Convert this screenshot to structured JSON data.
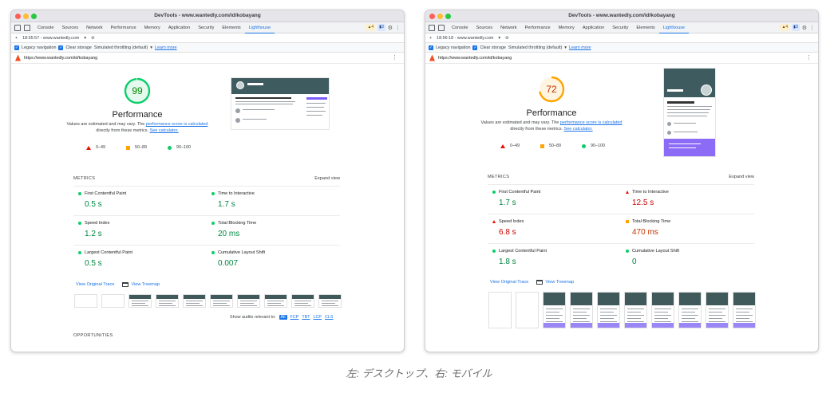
{
  "caption": "左: デスクトップ、右: モバイル",
  "colors": {
    "pass": "#0cce6b",
    "average": "#ffa400",
    "fail": "#eb0f00",
    "link": "#1a73e8"
  },
  "windows": {
    "left": {
      "title": "DevTools - www.wantedly.com/id/kobayang",
      "tabs": [
        "Console",
        "Sources",
        "Network",
        "Performance",
        "Memory",
        "Application",
        "Security",
        "Elements",
        "Lighthouse"
      ],
      "active_tab": "Lighthouse",
      "badges": {
        "warnings": "4",
        "messages": "3"
      },
      "session": "18:55:57 - www.wantedly.com",
      "options": {
        "legacy": "Legacy navigation",
        "clear": "Clear storage",
        "throttle": "Simulated throttling (default)",
        "learn": "Learn more"
      },
      "url": "https://www.wantedly.com/id/kobayang",
      "score": 99,
      "score_color": "#0cce6b",
      "score_text_color": "#008800",
      "score_bg": "#e6f9ee",
      "category": "Performance",
      "desc_1": "Values are estimated and may vary. The ",
      "desc_link": "performance score is calculated",
      "desc_2": " directly from these metrics. ",
      "desc_calc": "See calculator.",
      "legend": {
        "fail": "0–49",
        "average": "50–89",
        "pass": "90–100"
      },
      "metrics_label": "METRICS",
      "expand": "Expand view",
      "metrics": [
        {
          "name": "First Contentful Paint",
          "value": "0.5 s",
          "rating": "pass"
        },
        {
          "name": "Time to Interactive",
          "value": "1.7 s",
          "rating": "pass"
        },
        {
          "name": "Speed Index",
          "value": "1.2 s",
          "rating": "pass"
        },
        {
          "name": "Total Blocking Time",
          "value": "20 ms",
          "rating": "pass"
        },
        {
          "name": "Largest Contentful Paint",
          "value": "0.5 s",
          "rating": "pass"
        },
        {
          "name": "Cumulative Layout Shift",
          "value": "0.007",
          "rating": "pass"
        }
      ],
      "view_trace": "View Original Trace",
      "view_treemap": "View Treemap",
      "show_audits": "Show audits relevant to:",
      "audit_chips": [
        "All",
        "FCP",
        "TBT",
        "LCP",
        "CLS"
      ],
      "opportunities": "OPPORTUNITIES"
    },
    "right": {
      "title": "DevTools - www.wantedly.com/id/kobayang",
      "tabs": [
        "Console",
        "Sources",
        "Network",
        "Performance",
        "Memory",
        "Application",
        "Security",
        "Elements",
        "Lighthouse"
      ],
      "active_tab": "Lighthouse",
      "badges": {
        "warnings": "4",
        "messages": "3"
      },
      "session": "18:56:18 - www.wantedly.com",
      "options": {
        "legacy": "Legacy navigation",
        "clear": "Clear storage",
        "throttle": "Simulated throttling (default)",
        "learn": "Learn more"
      },
      "url": "https://www.wantedly.com/id/kobayang",
      "score": 72,
      "score_color": "#ffa400",
      "score_text_color": "#c33300",
      "score_bg": "#fff4e0",
      "category": "Performance",
      "desc_1": "Values are estimated and may vary. The ",
      "desc_link": "performance score is calculated",
      "desc_2": " directly from these metrics. ",
      "desc_calc": "See calculator.",
      "legend": {
        "fail": "0–49",
        "average": "50–89",
        "pass": "90–100"
      },
      "metrics_label": "METRICS",
      "expand": "Expand view",
      "metrics": [
        {
          "name": "First Contentful Paint",
          "value": "1.7 s",
          "rating": "pass"
        },
        {
          "name": "Time to Interactive",
          "value": "12.5 s",
          "rating": "fail"
        },
        {
          "name": "Speed Index",
          "value": "6.8 s",
          "rating": "fail"
        },
        {
          "name": "Total Blocking Time",
          "value": "470 ms",
          "rating": "avg"
        },
        {
          "name": "Largest Contentful Paint",
          "value": "1.8 s",
          "rating": "pass"
        },
        {
          "name": "Cumulative Layout Shift",
          "value": "0",
          "rating": "pass"
        }
      ],
      "view_trace": "View Original Trace",
      "view_treemap": "View Treemap"
    }
  }
}
